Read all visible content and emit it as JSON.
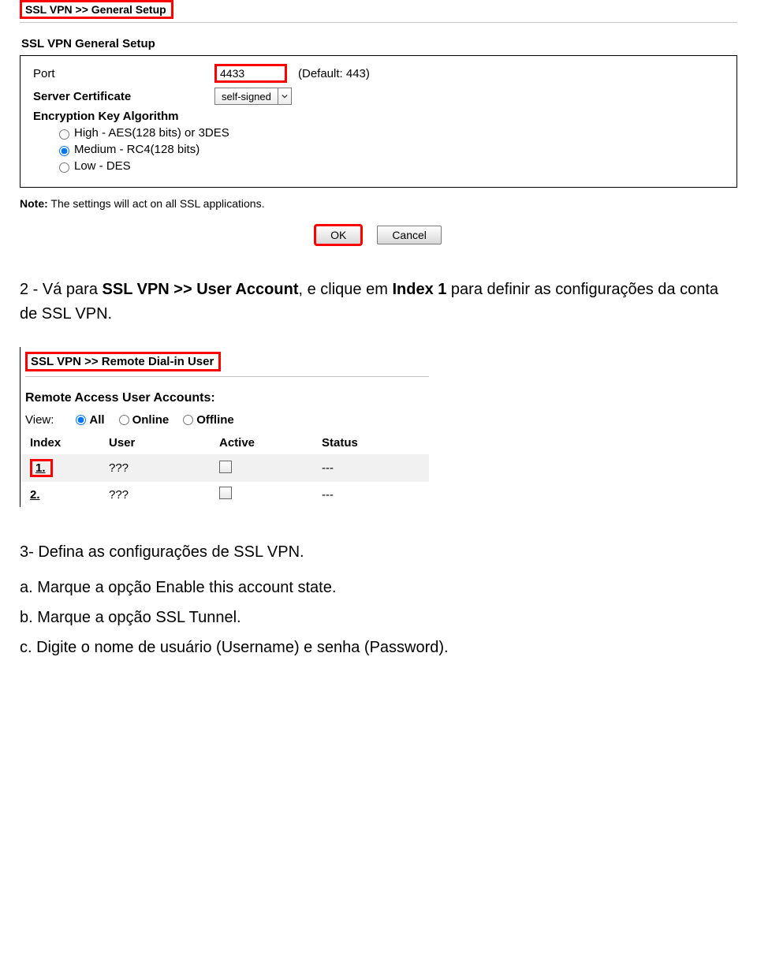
{
  "screenshot1": {
    "breadcrumb": "SSL VPN >> General Setup",
    "section_title": "SSL VPN General Setup",
    "rows": {
      "port_label": "Port",
      "port_value": "4433",
      "port_default": "(Default: 443)",
      "cert_label": "Server Certificate",
      "cert_value": "self-signed",
      "enc_label": "Encryption Key Algorithm",
      "enc_options": {
        "high": "High - AES(128 bits) or 3DES",
        "medium": "Medium - RC4(128 bits)",
        "low": "Low - DES"
      }
    },
    "note_label": "Note:",
    "note_text": "The settings will act on all SSL applications.",
    "buttons": {
      "ok": "OK",
      "cancel": "Cancel"
    }
  },
  "step2": {
    "prefix": "2 - Vá para ",
    "b1": "SSL VPN >> User Account",
    "mid1": ", e clique em ",
    "b2": "Index 1",
    "mid2": " para definir as configurações da conta de SSL VPN."
  },
  "screenshot2": {
    "breadcrumb": "SSL VPN >> Remote Dial-in User",
    "rau_title": "Remote Access User Accounts:",
    "view_label": "View:",
    "view_options": {
      "all": "All",
      "online": "Online",
      "offline": "Offline"
    },
    "headers": {
      "index": "Index",
      "user": "User",
      "active": "Active",
      "status": "Status"
    },
    "rows": [
      {
        "index": "1.",
        "user": "???",
        "status": "---",
        "highlighted": true
      },
      {
        "index": "2.",
        "user": "???",
        "status": "---",
        "highlighted": false
      }
    ]
  },
  "step3": {
    "title": "3- Defina as configurações de SSL VPN.",
    "a_pre": "a. Marque a opção ",
    "a_b": "Enable this account state",
    "a_post": ".",
    "b_pre": "b. Marque a opção ",
    "b_b": "SSL Tunnel",
    "b_post": ".",
    "c_pre": "c. Digite o nome de usuário (",
    "c_b1": "Username",
    "c_mid": ") e senha (",
    "c_b2": "Password",
    "c_post": ")."
  }
}
